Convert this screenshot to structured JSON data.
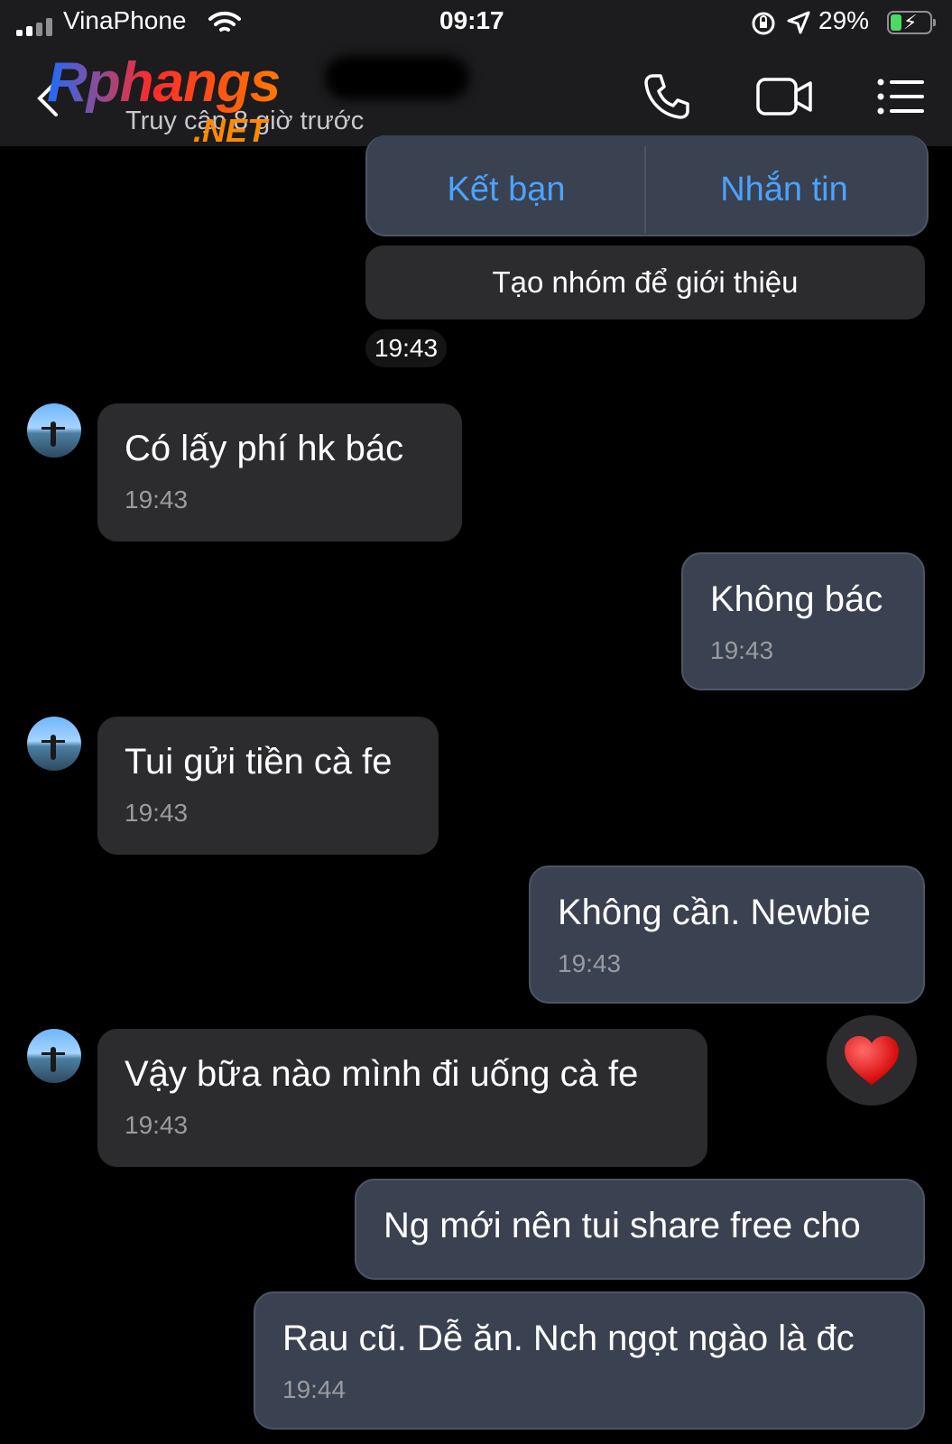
{
  "status_bar": {
    "carrier": "VinaPhone",
    "time": "09:17",
    "battery": "29%"
  },
  "header": {
    "logo": "Rphangs",
    "logo_sub": ".NET",
    "subtitle": "Truy cập 8 giờ trước"
  },
  "intro": {
    "add_friend": "Kết bạn",
    "message": "Nhắn tin",
    "create_group": "Tạo nhóm để giới thiệu",
    "time": "19:43"
  },
  "messages": [
    {
      "side": "in",
      "text": "Có lấy phí hk bác",
      "time": "19:43"
    },
    {
      "side": "out",
      "text": "Không bác",
      "time": "19:43"
    },
    {
      "side": "in",
      "text": "Tui gửi tiền cà fe",
      "time": "19:43"
    },
    {
      "side": "out",
      "text": "Không cần. Newbie",
      "time": "19:43"
    },
    {
      "side": "in",
      "text": "Vậy bữa nào mình đi uống cà fe",
      "time": "19:43",
      "reaction": "heart"
    },
    {
      "side": "out",
      "text": "Ng mới nên tui share free cho",
      "time": ""
    },
    {
      "side": "out",
      "text": "Rau cũ. Dễ ăn. Nch ngọt ngào là đc",
      "time": "19:44"
    }
  ],
  "colors": {
    "accent": "#4aa3ff",
    "out_bubble": "#3a4150",
    "in_bubble": "#2c2c2e",
    "battery_fill": "#4cd964"
  }
}
